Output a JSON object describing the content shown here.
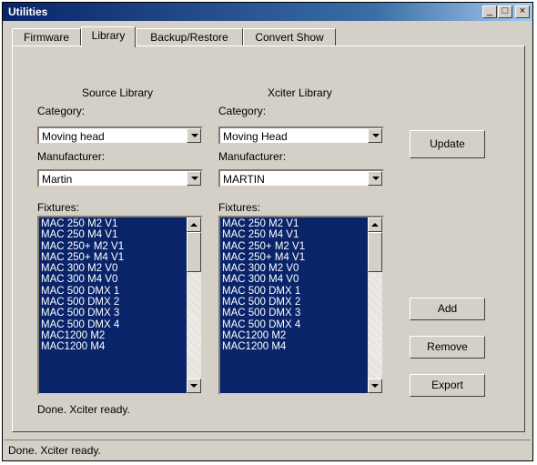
{
  "window": {
    "title": "Utilities",
    "minimize_glyph": "_",
    "maximize_glyph": "□",
    "close_glyph": "×"
  },
  "tabs": [
    {
      "label": "Firmware",
      "active": false
    },
    {
      "label": "Library",
      "active": true
    },
    {
      "label": "Backup/Restore",
      "active": false
    },
    {
      "label": "Convert Show",
      "active": false
    }
  ],
  "source": {
    "heading": "Source Library",
    "category_label": "Category:",
    "category_value": "Moving head",
    "manufacturer_label": "Manufacturer:",
    "manufacturer_value": "Martin",
    "fixtures_label": "Fixtures:",
    "fixtures": [
      "MAC 250 M2 V1",
      "MAC 250 M4 V1",
      "MAC 250+ M2 V1",
      "MAC 250+ M4 V1",
      "MAC 300 M2 V0",
      "MAC 300 M4 V0",
      "MAC 500 DMX 1",
      "MAC 500 DMX 2",
      "MAC 500 DMX 3",
      "MAC 500 DMX 4",
      "MAC1200 M2",
      "MAC1200 M4"
    ]
  },
  "xciter": {
    "heading": "Xciter Library",
    "category_label": "Category:",
    "category_value": "Moving Head",
    "manufacturer_label": "Manufacturer:",
    "manufacturer_value": "MARTIN",
    "fixtures_label": "Fixtures:",
    "fixtures": [
      "MAC 250 M2 V1",
      "MAC 250 M4 V1",
      "MAC 250+ M2 V1",
      "MAC 250+ M4 V1",
      "MAC 300 M2 V0",
      "MAC 300 M4 V0",
      "MAC 500 DMX 1",
      "MAC 500 DMX 2",
      "MAC 500 DMX 3",
      "MAC 500 DMX 4",
      "MAC1200 M2",
      "MAC1200 M4"
    ]
  },
  "buttons": {
    "update": "Update",
    "add": "Add",
    "remove": "Remove",
    "export": "Export"
  },
  "panel_status": "Done. Xciter ready.",
  "status_bar": "Done. Xciter ready.",
  "colors": {
    "selection": "#0a246a",
    "face": "#d4d0c8",
    "title_start": "#0a246a",
    "title_end": "#a6caf0"
  }
}
